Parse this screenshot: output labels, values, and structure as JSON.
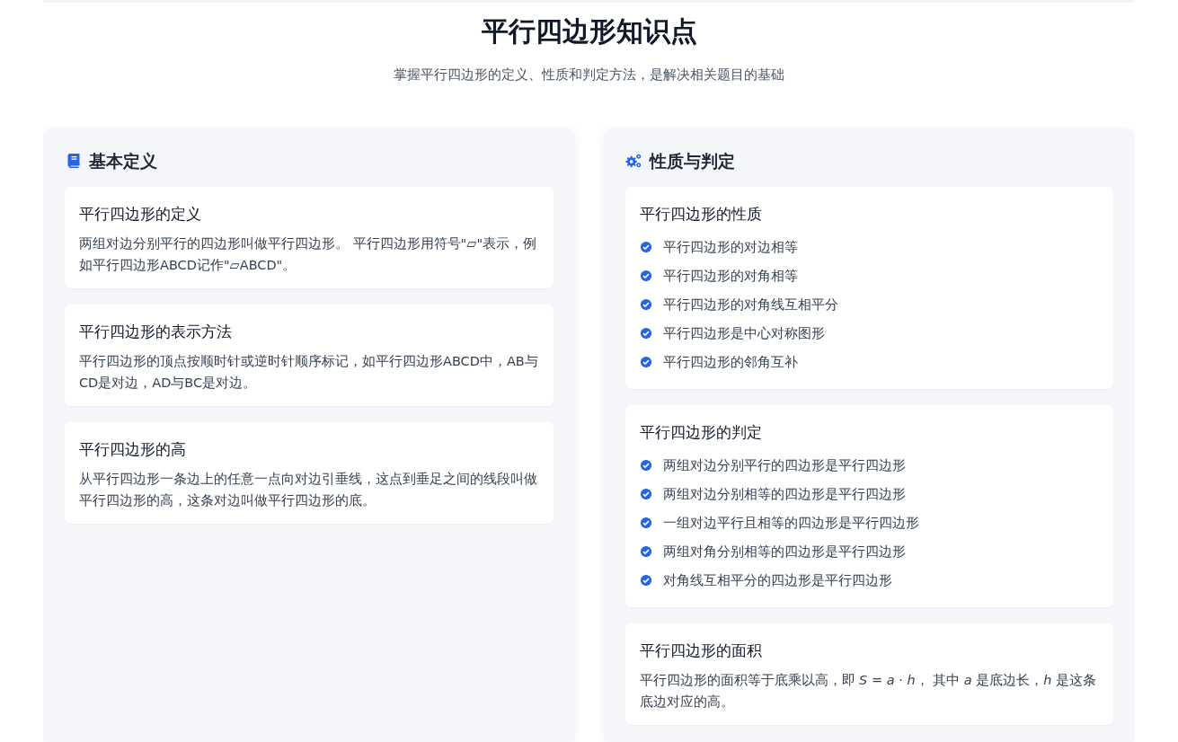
{
  "header": {
    "title": "平行四边形知识点",
    "subtitle": "掌握平行四边形的定义、性质和判定方法，是解决相关题目的基础"
  },
  "panels": [
    {
      "title": "基本定义",
      "kind": "book",
      "cards": [
        {
          "kind": "text",
          "title": "平行四边形的定义",
          "text": "两组对边分别平行的四边形叫做平行四边形。 平行四边形用符号\"▱\"表示，例如平行四边形ABCD记作\"▱ABCD\"。"
        },
        {
          "kind": "text",
          "title": "平行四边形的表示方法",
          "text": "平行四边形的顶点按顺时针或逆时针顺序标记，如平行四边形ABCD中，AB与CD是对边，AD与BC是对边。"
        },
        {
          "kind": "text",
          "title": "平行四边形的高",
          "text": "从平行四边形一条边上的任意一点向对边引垂线，这点到垂足之间的线段叫做平行四边形的高，这条对边叫做平行四边形的底。"
        }
      ]
    },
    {
      "title": "性质与判定",
      "kind": "gears",
      "cards": [
        {
          "kind": "list",
          "title": "平行四边形的性质",
          "items": [
            "平行四边形的对边相等",
            "平行四边形的对角相等",
            "平行四边形的对角线互相平分",
            "平行四边形是中心对称图形",
            "平行四边形的邻角互补"
          ]
        },
        {
          "kind": "list",
          "title": "平行四边形的判定",
          "items": [
            "两组对边分别平行的四边形是平行四边形",
            "两组对边分别相等的四边形是平行四边形",
            "一组对边平行且相等的四边形是平行四边形",
            "两组对角分别相等的四边形是平行四边形",
            "对角线互相平分的四边形是平行四边形"
          ]
        },
        {
          "kind": "text",
          "title": "平行四边形的面积",
          "text": "平行四边形的面积等于底乘以高，即 *S* = *a* · *h*， 其中 *a* 是底边长，*h* 是这条底边对应的高。"
        }
      ]
    }
  ]
}
